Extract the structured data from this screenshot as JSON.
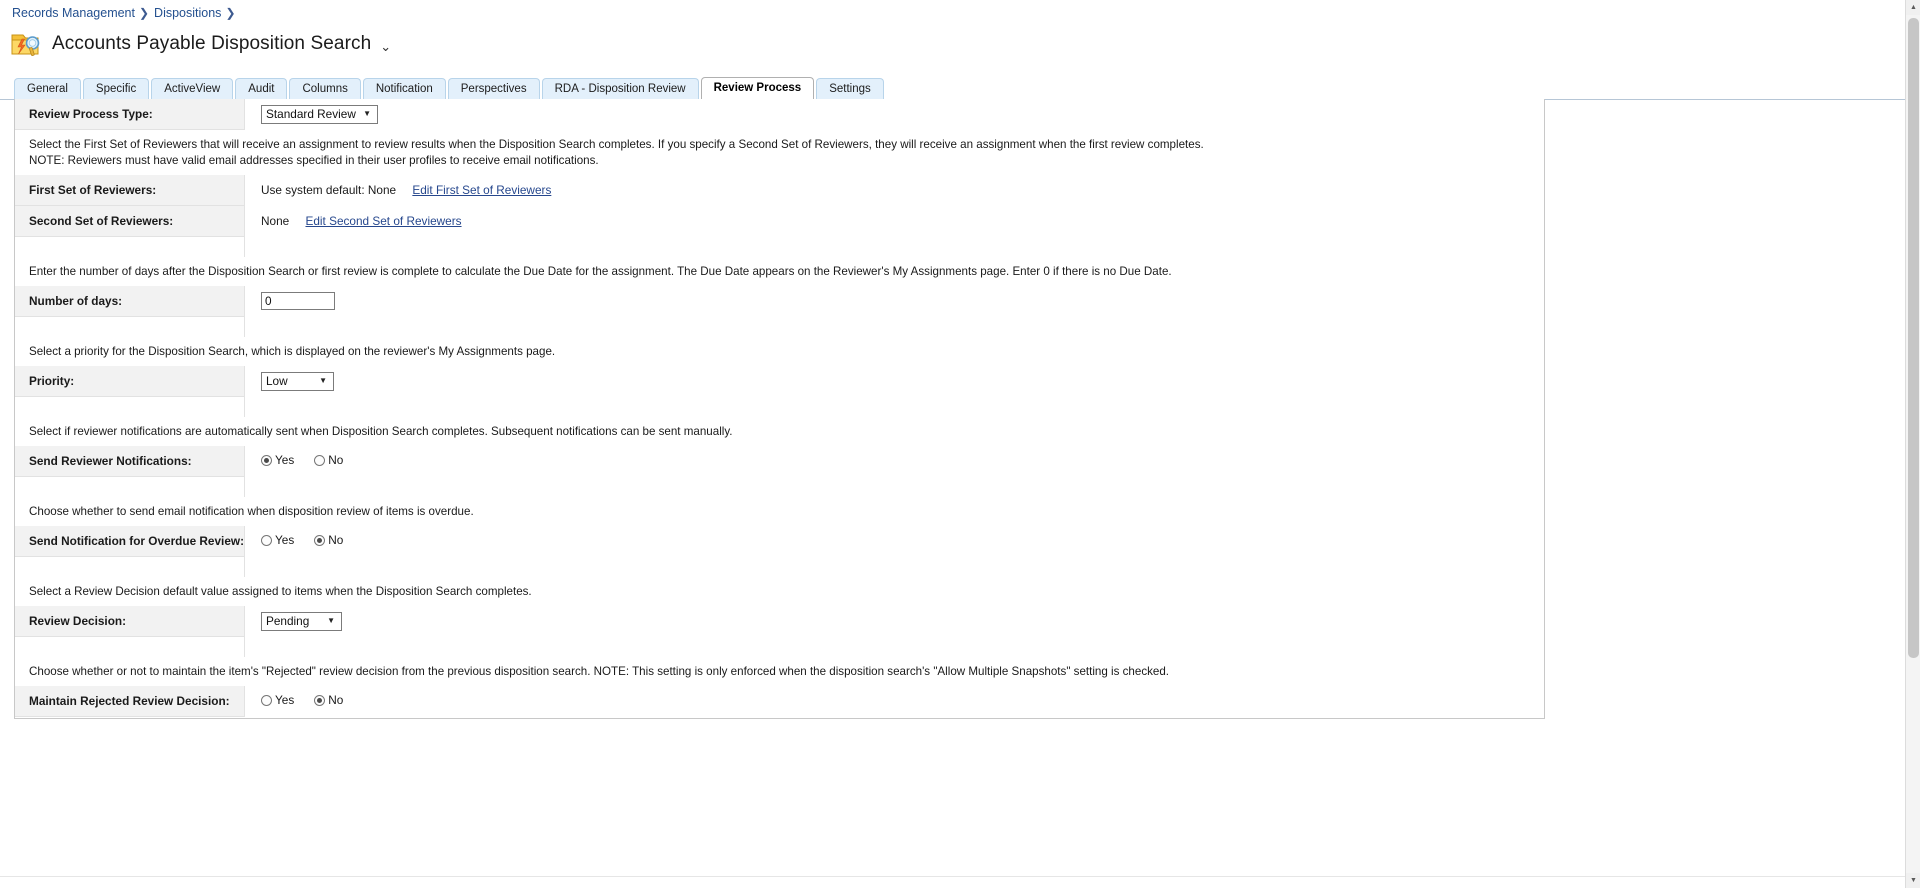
{
  "breadcrumb": {
    "items": [
      {
        "label": "Records Management",
        "sep": "❯"
      },
      {
        "label": "Dispositions",
        "sep": "❯"
      }
    ]
  },
  "header": {
    "title": "Accounts Payable Disposition Search",
    "chevron": "⌄",
    "icon_name": "disposition-search-icon"
  },
  "tabs": [
    {
      "label": "General",
      "active": false
    },
    {
      "label": "Specific",
      "active": false
    },
    {
      "label": "ActiveView",
      "active": false
    },
    {
      "label": "Audit",
      "active": false
    },
    {
      "label": "Columns",
      "active": false
    },
    {
      "label": "Notification",
      "active": false
    },
    {
      "label": "Perspectives",
      "active": false
    },
    {
      "label": "RDA - Disposition Review",
      "active": false
    },
    {
      "label": "Review Process",
      "active": true
    },
    {
      "label": "Settings",
      "active": false
    }
  ],
  "form": {
    "review_process_type": {
      "label": "Review Process Type:",
      "value": "Standard Review",
      "options": [
        "Standard Review"
      ],
      "arrow": "▼"
    },
    "reviewers_description": "Select the First Set of Reviewers that will receive an assignment to review results when the Disposition Search completes. If you specify a Second Set of Reviewers, they will receive an assignment when the first review completes.",
    "reviewers_note": "NOTE: Reviewers must have valid email addresses specified in their user profiles to receive email notifications.",
    "first_set": {
      "label": "First Set of Reviewers:",
      "value": "Use system default: None",
      "link": "Edit First Set of Reviewers"
    },
    "second_set": {
      "label": "Second Set of Reviewers:",
      "value": "None",
      "link": "Edit Second Set of Reviewers"
    },
    "days_description": "Enter the number of days after the Disposition Search or first review is complete to calculate the Due Date for the assignment. The Due Date appears on the Reviewer's My Assignments page. Enter 0 if there is no Due Date.",
    "number_of_days": {
      "label": "Number of days:",
      "value": "0"
    },
    "priority_description": "Select a priority for the Disposition Search, which is displayed on the reviewer's My Assignments page.",
    "priority": {
      "label": "Priority:",
      "value": "Low",
      "options": [
        "Low"
      ],
      "arrow": "▼"
    },
    "notifications_description": "Select if reviewer notifications are automatically sent when Disposition Search completes. Subsequent notifications can be sent manually.",
    "send_reviewer_notifications": {
      "label": "Send Reviewer Notifications:",
      "yes_label": "Yes",
      "no_label": "No",
      "selected": "Yes"
    },
    "overdue_description": "Choose whether to send email notification when disposition review of items is overdue.",
    "send_notification_overdue": {
      "label": "Send Notification for Overdue Review:",
      "yes_label": "Yes",
      "no_label": "No",
      "selected": "No"
    },
    "decision_description": "Select a Review Decision default value assigned to items when the Disposition Search completes.",
    "review_decision": {
      "label": "Review Decision:",
      "value": "Pending",
      "options": [
        "Pending"
      ],
      "arrow": "▼"
    },
    "rejected_description": "Choose whether or not to maintain the item's \"Rejected\" review decision from the previous disposition search. NOTE: This setting is only enforced when the disposition search's \"Allow Multiple Snapshots\" setting is checked.",
    "maintain_rejected": {
      "label": "Maintain Rejected Review Decision:",
      "yes_label": "Yes",
      "no_label": "No",
      "selected": "No"
    }
  },
  "scrollbar": {
    "up_arrow": "▲",
    "down_arrow": "▼"
  },
  "colors": {
    "link": "#26478d",
    "tab_inactive_bg": "#e3f0fb",
    "label_cell_bg": "#f2f2f2",
    "page_bg": "#ffffff"
  }
}
